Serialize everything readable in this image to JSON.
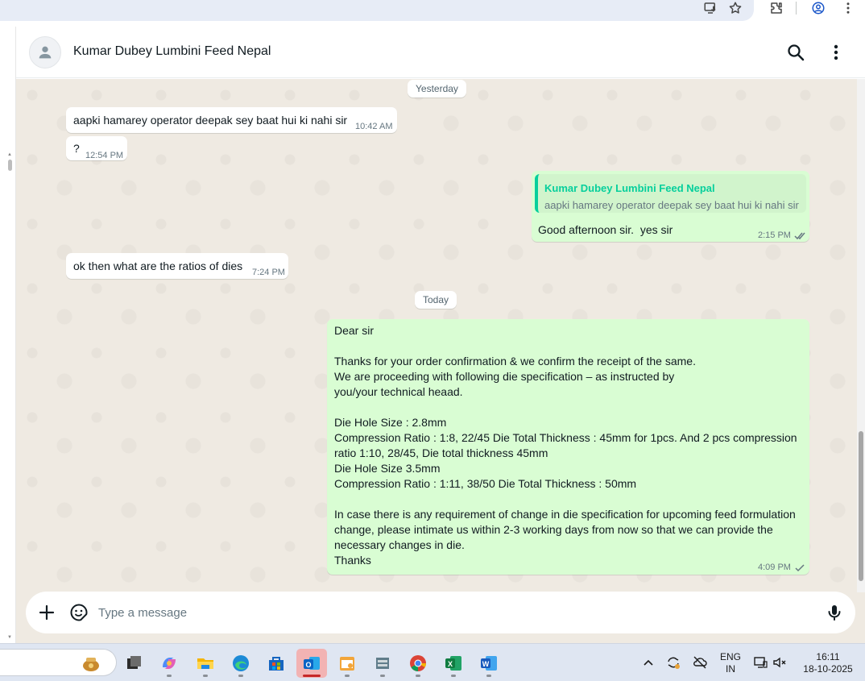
{
  "chat": {
    "contact_name": "Kumar Dubey Lumbini Feed Nepal",
    "date_yesterday": "Yesterday",
    "date_today": "Today",
    "messages": [
      {
        "direction": "in",
        "text": "aapki hamarey operator deepak sey baat hui ki nahi sir",
        "time": "10:42 AM"
      },
      {
        "direction": "in",
        "text": "?",
        "time": "12:54 PM"
      },
      {
        "direction": "out",
        "quote_author": "Kumar Dubey Lumbini Feed Nepal",
        "quote_text": "aapki hamarey operator deepak sey baat hui ki nahi sir",
        "text": "Good afternoon sir.  yes sir",
        "time": "2:15 PM",
        "status": "read"
      },
      {
        "direction": "in",
        "text": "ok then what are the ratios of dies",
        "time": "7:24 PM"
      },
      {
        "direction": "out",
        "time": "4:09 PM",
        "status": "sent",
        "lines": [
          "Dear  sir",
          "",
          "Thanks for your order confirmation & we confirm the receipt of the same.",
          "We are proceeding with following die specification – as instructed by",
          "you/your technical heaad.",
          "",
          "Die Hole Size : 2.8mm",
          "Compression Ratio : 1:8, 22/45 Die Total Thickness : 45mm for 1pcs. And 2 pcs compression",
          "ratio 1:10, 28/45, Die total thickness 45mm",
          "Die Hole Size 3.5mm",
          "Compression Ratio : 1:11, 38/50 Die Total Thickness : 50mm",
          "",
          "In case there is any requirement of change in die specification for upcoming feed formulation",
          "change, please intimate us within 2-3 working days from now so that we can provide the",
          "necessary changes in die.",
          "Thanks"
        ]
      }
    ]
  },
  "composer": {
    "placeholder": "Type a message"
  },
  "taskbar": {
    "language": "ENG",
    "region": "IN",
    "time": "16:11",
    "date": "18-10-2025"
  },
  "colors": {
    "incoming_bubble": "#ffffff",
    "outgoing_bubble": "#d9fdd3",
    "chat_background": "#efeae2",
    "quote_accent": "#06cf9c",
    "read_tick": "#53bdeb"
  }
}
